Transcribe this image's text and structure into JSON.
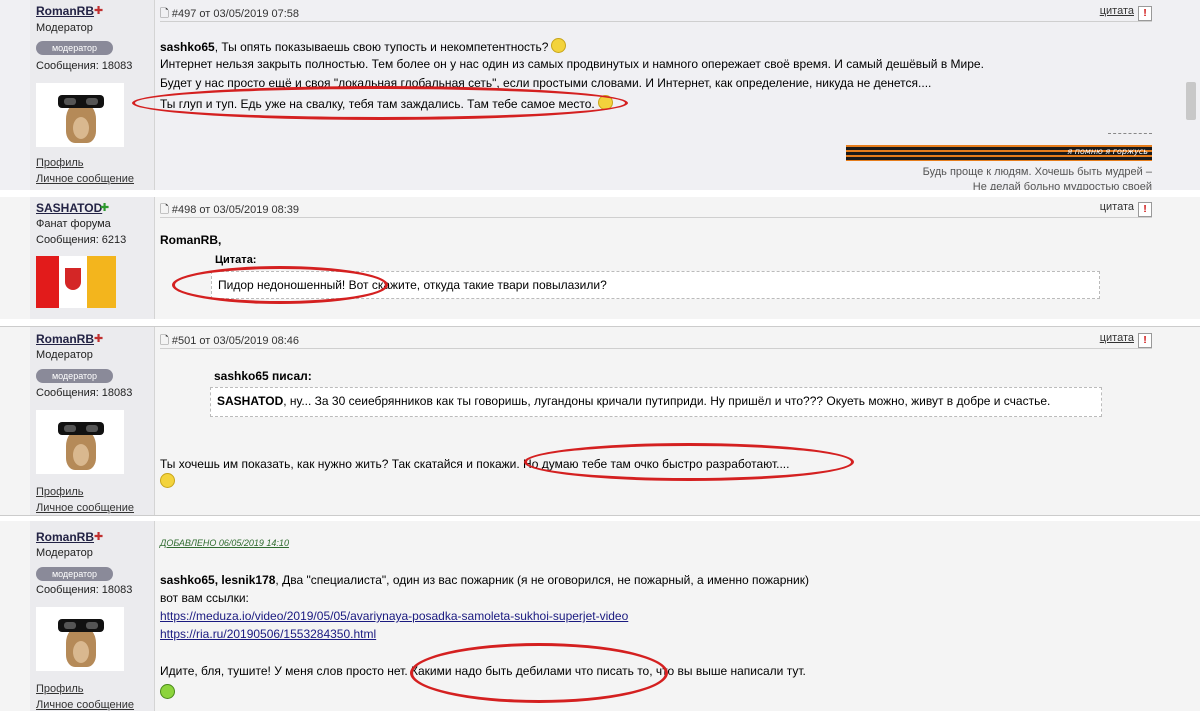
{
  "posts": [
    {
      "user": {
        "name": "RomanRB",
        "role": "Модератор",
        "badge": "модератор",
        "messages": "Сообщения: 18083",
        "profile": "Профиль",
        "pm": "Личное сообщение"
      },
      "meta": "#497 от 03/05/2019 07:58",
      "quote_label": "цитата",
      "lines": {
        "l1_bold": "sashko65",
        "l1_rest": ", Ты опять показываешь свою тупость и некомпетентность?",
        "l2": "Интернет нельзя закрыть полностью. Тем более он у нас один из самых продвинутых и намного опережает своё время. И самый дешёвый в Мире.",
        "l3": "Будет у нас просто ещё и своя \"локальная глобальная сеть\", если простыми словами. И Интернет, как определение, никуда не денется....",
        "l4": "Ты глуп и туп. Едь уже на свалку, тебя там заждались. Там тебе самое место."
      },
      "signature": {
        "ribbon_text": "я помню я горжусь",
        "line1": "Будь проще к людям. Хочешь быть мудрей –",
        "line2": "Не делай больно мудростью своей"
      }
    },
    {
      "user": {
        "name": "SASHATOD",
        "role": "Фанат форума",
        "messages": "Сообщения: 6213"
      },
      "meta": "#498 от 03/05/2019 08:39",
      "quote_label": "цитата",
      "address": "RomanRB,",
      "quote_title": "Цитата:",
      "quote_text": "Пидор недоношенный! Вот скажите, откуда такие твари повылазили?"
    },
    {
      "user": {
        "name": "RomanRB",
        "role": "Модератор",
        "badge": "модератор",
        "messages": "Сообщения: 18083",
        "profile": "Профиль",
        "pm": "Личное сообщение"
      },
      "meta": "#501 от 03/05/2019 08:46",
      "quote_label": "цитата",
      "quote_title": "sashko65 писал:",
      "quote_bold": "SASHATOD",
      "quote_text": ", ну... За 30 сеиебрянников как ты говоришь, лугандоны кричали путиприди. Ну пришёл и что??? Окуеть можно, живут в добре и счастье.",
      "reply": "Ты хочешь им показать, как нужно жить? Так скатайся и покажи. Но думаю тебе там очко быстро разработают...."
    },
    {
      "user": {
        "name": "RomanRB",
        "role": "Модератор",
        "badge": "модератор",
        "messages": "Сообщения: 18083",
        "profile": "Профиль",
        "pm": "Личное сообщение"
      },
      "added": "ДОБАВЛЕНО 06/05/2019 14:10",
      "l1_bold": "sashko65, lesnik178",
      "l1_rest": ", Два \"специалиста\", один из вас пожарник (я не оговорился, не пожарный, а именно пожарник)",
      "l2": "вот вам ссылки:",
      "link1": "https://meduza.io/video/2019/05/05/avariynaya-posadka-samoleta-sukhoi-superjet-video",
      "link2": "https://ria.ru/20190506/1553284350.html",
      "l3": "Идите, бля, тушите! У меня слов просто нет. Какими надо быть дебилами что писать то, что вы выше написали тут."
    }
  ]
}
